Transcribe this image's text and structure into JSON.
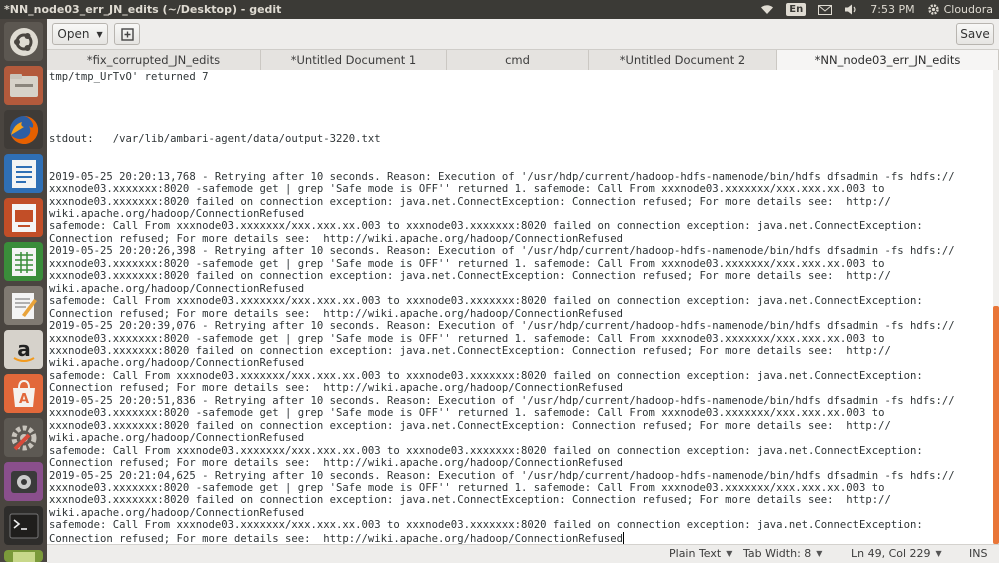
{
  "window": {
    "title": "*NN_node03_err_JN_edits (~/Desktop) - gedit"
  },
  "system_tray": {
    "language": "En",
    "time": "7:53 PM",
    "user": "Cloudora",
    "icons": [
      "wifi-icon",
      "keyboard-language-icon",
      "mail-icon",
      "volume-icon",
      "settings-gear-icon"
    ]
  },
  "launcher": {
    "items": [
      "ubuntu-dash-icon",
      "files-icon",
      "firefox-icon",
      "writer-icon",
      "impress-icon",
      "calc-icon",
      "text-editor-icon",
      "amazon-icon",
      "software-center-icon",
      "system-settings-icon",
      "video-icon",
      "terminal-icon",
      "device-icon"
    ]
  },
  "toolbar": {
    "open_label": "Open",
    "new_tab_icon": "new-document-icon",
    "save_label": "Save"
  },
  "tabs": [
    {
      "label": "*fix_corrupted_JN_edits",
      "active": false
    },
    {
      "label": "*Untitled Document 1",
      "active": false
    },
    {
      "label": "cmd",
      "active": false
    },
    {
      "label": "*Untitled Document 2",
      "active": false
    },
    {
      "label": "*NN_node03_err_JN_edits",
      "active": true
    }
  ],
  "editor": {
    "content": "tmp/tmp_UrTvO' returned 7\n\n\n\n\nstdout:   /var/lib/ambari-agent/data/output-3220.txt\n\n\n2019-05-25 20:20:13,768 - Retrying after 10 seconds. Reason: Execution of '/usr/hdp/current/hadoop-hdfs-namenode/bin/hdfs dfsadmin -fs hdfs://\nxxxnode03.xxxxxxx:8020 -safemode get | grep 'Safe mode is OFF'' returned 1. safemode: Call From xxxnode03.xxxxxxx/xxx.xxx.xx.003 to\nxxxnode03.xxxxxxx:8020 failed on connection exception: java.net.ConnectException: Connection refused; For more details see:  http://\nwiki.apache.org/hadoop/ConnectionRefused\nsafemode: Call From xxxnode03.xxxxxxx/xxx.xxx.xx.003 to xxxnode03.xxxxxxx:8020 failed on connection exception: java.net.ConnectException:\nConnection refused; For more details see:  http://wiki.apache.org/hadoop/ConnectionRefused\n2019-05-25 20:20:26,398 - Retrying after 10 seconds. Reason: Execution of '/usr/hdp/current/hadoop-hdfs-namenode/bin/hdfs dfsadmin -fs hdfs://\nxxxnode03.xxxxxxx:8020 -safemode get | grep 'Safe mode is OFF'' returned 1. safemode: Call From xxxnode03.xxxxxxx/xxx.xxx.xx.003 to\nxxxnode03.xxxxxxx:8020 failed on connection exception: java.net.ConnectException: Connection refused; For more details see:  http://\nwiki.apache.org/hadoop/ConnectionRefused\nsafemode: Call From xxxnode03.xxxxxxx/xxx.xxx.xx.003 to xxxnode03.xxxxxxx:8020 failed on connection exception: java.net.ConnectException:\nConnection refused; For more details see:  http://wiki.apache.org/hadoop/ConnectionRefused\n2019-05-25 20:20:39,076 - Retrying after 10 seconds. Reason: Execution of '/usr/hdp/current/hadoop-hdfs-namenode/bin/hdfs dfsadmin -fs hdfs://\nxxxnode03.xxxxxxx:8020 -safemode get | grep 'Safe mode is OFF'' returned 1. safemode: Call From xxxnode03.xxxxxxx/xxx.xxx.xx.003 to\nxxxnode03.xxxxxxx:8020 failed on connection exception: java.net.ConnectException: Connection refused; For more details see:  http://\nwiki.apache.org/hadoop/ConnectionRefused\nsafemode: Call From xxxnode03.xxxxxxx/xxx.xxx.xx.003 to xxxnode03.xxxxxxx:8020 failed on connection exception: java.net.ConnectException:\nConnection refused; For more details see:  http://wiki.apache.org/hadoop/ConnectionRefused\n2019-05-25 20:20:51,836 - Retrying after 10 seconds. Reason: Execution of '/usr/hdp/current/hadoop-hdfs-namenode/bin/hdfs dfsadmin -fs hdfs://\nxxxnode03.xxxxxxx:8020 -safemode get | grep 'Safe mode is OFF'' returned 1. safemode: Call From xxxnode03.xxxxxxx/xxx.xxx.xx.003 to\nxxxnode03.xxxxxxx:8020 failed on connection exception: java.net.ConnectException: Connection refused; For more details see:  http://\nwiki.apache.org/hadoop/ConnectionRefused\nsafemode: Call From xxxnode03.xxxxxxx/xxx.xxx.xx.003 to xxxnode03.xxxxxxx:8020 failed on connection exception: java.net.ConnectException:\nConnection refused; For more details see:  http://wiki.apache.org/hadoop/ConnectionRefused\n2019-05-25 20:21:04,625 - Retrying after 10 seconds. Reason: Execution of '/usr/hdp/current/hadoop-hdfs-namenode/bin/hdfs dfsadmin -fs hdfs://\nxxxnode03.xxxxxxx:8020 -safemode get | grep 'Safe mode is OFF'' returned 1. safemode: Call From xxxnode03.xxxxxxx/xxx.xxx.xx.003 to\nxxxnode03.xxxxxxx:8020 failed on connection exception: java.net.ConnectException: Connection refused; For more details see:  http://\nwiki.apache.org/hadoop/ConnectionRefused\nsafemode: Call From xxxnode03.xxxxxxx/xxx.xxx.xx.003 to xxxnode03.xxxxxxx:8020 failed on connection exception: java.net.ConnectException:\nConnection refused; For more details see:  http://wiki.apache.org/hadoop/ConnectionRefused"
  },
  "statusbar": {
    "language_mode": "Plain Text",
    "tab_width": "Tab Width: 8",
    "cursor_position": "Ln 49, Col 229",
    "insert_mode": "INS"
  },
  "colors": {
    "top_panel": "#3b3a36",
    "launcher_bg": "#4a4540",
    "scrollbar_accent": "#e97638"
  }
}
